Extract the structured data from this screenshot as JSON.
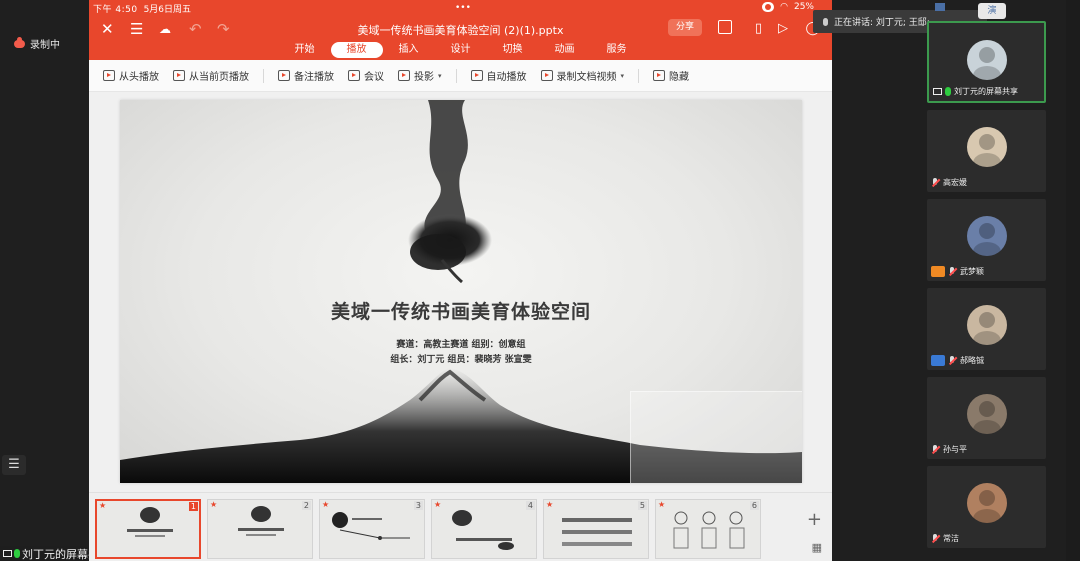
{
  "meeting": {
    "recording_label": "录制中",
    "sharer_label": "刘丁元的屏幕共享",
    "speaking_label": "正在讲话: 刘丁元; 王邸:",
    "speak_chip": "演"
  },
  "status_bar": {
    "time": "下午 4:50",
    "date": "5月6日周五",
    "battery": "25%"
  },
  "app": {
    "doc_title": "美域一传统书画美育体验空间 (2)(1).pptx",
    "share_label": "分享",
    "tabs": [
      "开始",
      "播放",
      "插入",
      "设计",
      "切换",
      "动画",
      "服务"
    ],
    "active_tab": "播放",
    "toolbar": {
      "from_start": "从头播放",
      "from_current": "从当前页播放",
      "notes_play": "备注播放",
      "meeting": "会议",
      "projection": "投影",
      "auto_play": "自动播放",
      "record_video": "录制文档视频",
      "hide": "隐藏"
    }
  },
  "slide": {
    "title": "美域一传统书画美育体验空间",
    "line1": "赛道：高教主赛道  组别：创意组",
    "line2": "组长：刘丁元  组员：裴晓芳 张宣雯"
  },
  "thumbnails": [
    {
      "num": "1",
      "selected": true
    },
    {
      "num": "2",
      "selected": false
    },
    {
      "num": "3",
      "selected": false
    },
    {
      "num": "4",
      "selected": false
    },
    {
      "num": "5",
      "selected": false
    },
    {
      "num": "6",
      "selected": false
    }
  ],
  "participants": [
    {
      "name": "刘丁元的屏幕共享",
      "active": true
    },
    {
      "name": "高宏媛",
      "active": false
    },
    {
      "name": "武梦颖",
      "active": false
    },
    {
      "name": "郝略铖",
      "active": false
    },
    {
      "name": "孙与平",
      "active": false
    },
    {
      "name": "常洁",
      "active": false
    }
  ],
  "colors": {
    "wps_accent": "#e8472c",
    "active_border": "#3c9a4e",
    "panel_bg": "#2c2c2c"
  }
}
